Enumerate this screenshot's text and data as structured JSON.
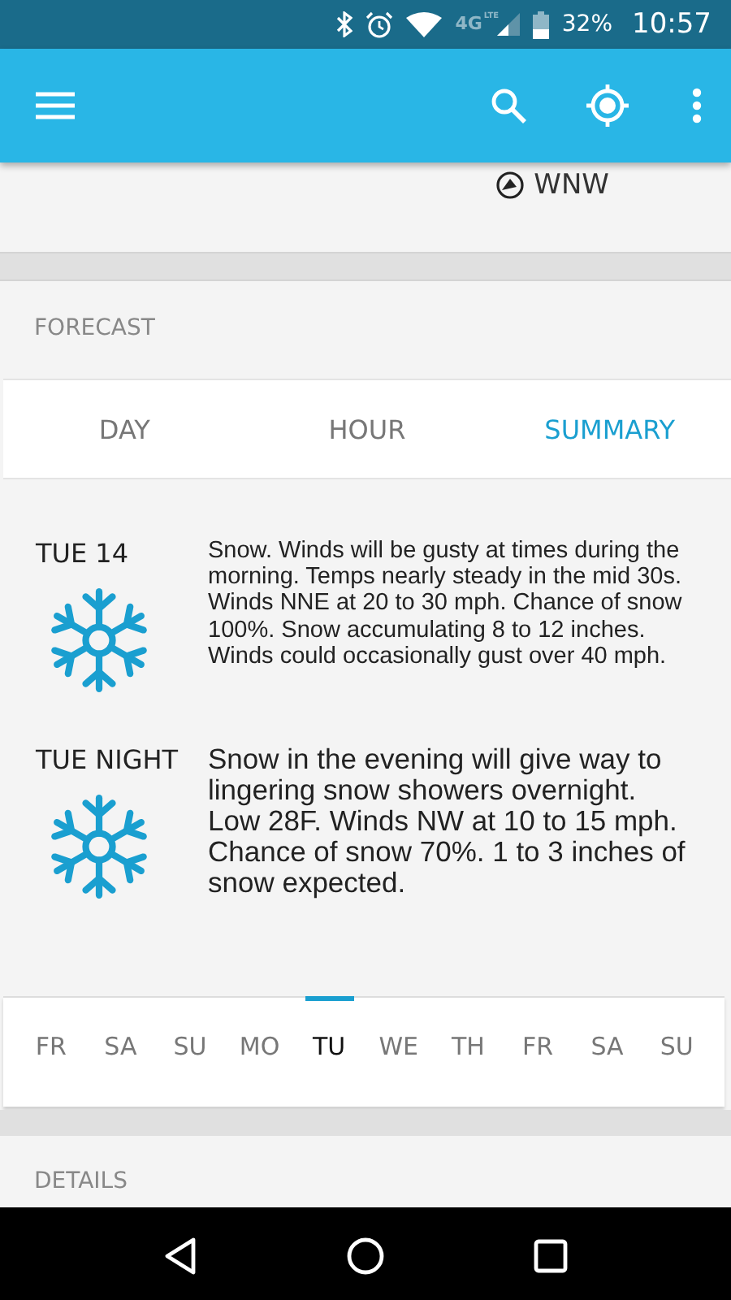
{
  "status_bar": {
    "network": "4G",
    "network_sub": "LTE",
    "battery": "32%",
    "time": "10:57"
  },
  "wind": {
    "direction": "WNW"
  },
  "forecast": {
    "title": "FORECAST",
    "tabs": [
      {
        "label": "DAY",
        "selected": false
      },
      {
        "label": "HOUR",
        "selected": false
      },
      {
        "label": "SUMMARY",
        "selected": true
      }
    ],
    "periods": [
      {
        "name": "TUE 14",
        "text": "Snow. Winds will be gusty at times during the morning. Temps nearly steady in the mid 30s. Winds NNE at 20 to 30 mph. Chance of snow 100%. Snow accumulating 8 to 12 inches. Winds could occasionally gust over 40 mph."
      },
      {
        "name": "TUE NIGHT",
        "text": "Snow in the evening will give way to lingering snow showers overnight. Low 28F. Winds NW at 10 to 15 mph. Chance of snow 70%. 1 to 3 inches of snow expected."
      }
    ],
    "days": [
      {
        "label": "FR",
        "selected": false
      },
      {
        "label": "SA",
        "selected": false
      },
      {
        "label": "SU",
        "selected": false
      },
      {
        "label": "MO",
        "selected": false
      },
      {
        "label": "TU",
        "selected": true
      },
      {
        "label": "WE",
        "selected": false
      },
      {
        "label": "TH",
        "selected": false
      },
      {
        "label": "FR",
        "selected": false
      },
      {
        "label": "SA",
        "selected": false
      },
      {
        "label": "SU",
        "selected": false
      }
    ]
  },
  "details": {
    "title": "DETAILS"
  }
}
